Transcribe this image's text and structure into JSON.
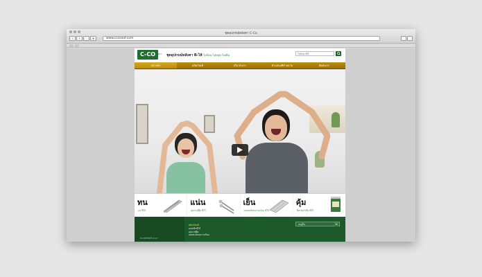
{
  "browser": {
    "window_title": "ชุดอุปกรณ์หลังคา C-Co",
    "url": "www.ccoroof.com"
  },
  "site": {
    "logo_text": "C-CO",
    "logo_badge": "ตรา",
    "tagline_main": "ชุดอุปกรณ์หลังคา B-ไห้",
    "tagline_sub": "ไม่ร้อน ไม่หลุด ไม่เยิม",
    "search_placeholder": "ใส่ค้นหาที่นี่",
    "menu": [
      {
        "label": "หน้าหลัก",
        "active": true
      },
      {
        "label": "ผลิตภัณฑ์"
      },
      {
        "label": "เกี่ยวกับเรา"
      },
      {
        "label": "ตำแหน่งที่จำหน่าย"
      },
      {
        "label": "ติดต่อเรา"
      }
    ]
  },
  "products": [
    {
      "big": "ทน",
      "sub": "แป ซีโก้"
    },
    {
      "big": "แน่น",
      "sub": "อุปกรณ์ยึด ซีโก้"
    },
    {
      "big": "เย็น",
      "sub": "แผ่นสะท้อนความร้อน ซีโก้"
    },
    {
      "big": "คุ้ม",
      "sub": "สีทากันรั่วซึม ซีโก้"
    }
  ],
  "footer": {
    "section_title": "ผลิตภัณฑ์",
    "links": [
      "แปเหล็กซีโก้",
      "อุปกรณ์ยึด",
      "แผ่นสะท้อนความร้อน"
    ],
    "select_value": "เมนูอื่น",
    "copyright": "สงวนลิขสิทธิ์ 2013"
  },
  "colors": {
    "brand_green": "#1f6f33",
    "menu_gold": "#b98b11",
    "footer_green": "#1d5a2b"
  }
}
